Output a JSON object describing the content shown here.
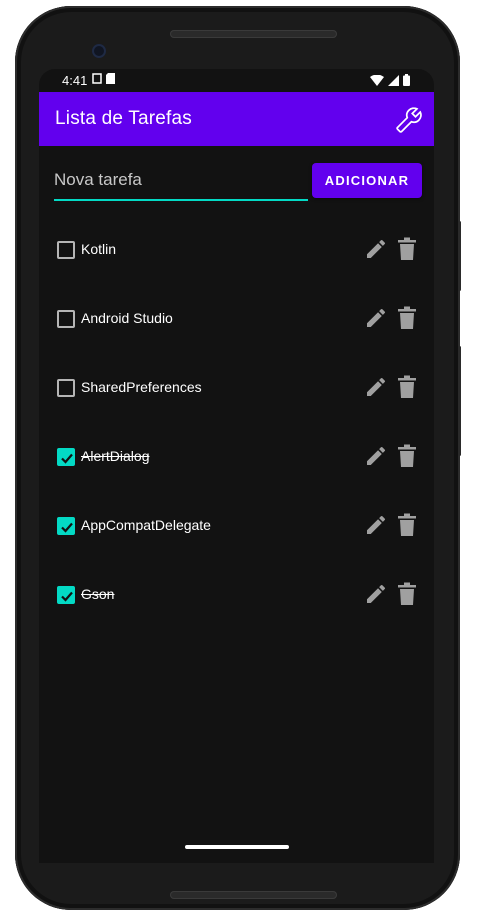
{
  "statusbar": {
    "time": "4:41"
  },
  "appbar": {
    "title": "Lista de Tarefas"
  },
  "input": {
    "value": "",
    "placeholder": "Nova tarefa"
  },
  "add_button": {
    "label": "ADICIONAR"
  },
  "tasks": [
    {
      "label": "Kotlin",
      "checked": false
    },
    {
      "label": "Android Studio",
      "checked": false
    },
    {
      "label": "SharedPreferences",
      "checked": false
    },
    {
      "label": "AlertDialog",
      "checked": true
    },
    {
      "label": "AppCompatDelegate",
      "checked": true
    },
    {
      "label": "Gson",
      "checked": true
    }
  ],
  "colors": {
    "primary": "#6200ee",
    "accent": "#03dac5",
    "background": "#121212",
    "icon_gray": "#a0a0a0"
  },
  "icons": {
    "settings": "wrench-icon",
    "edit": "pencil-icon",
    "delete": "trash-icon"
  }
}
